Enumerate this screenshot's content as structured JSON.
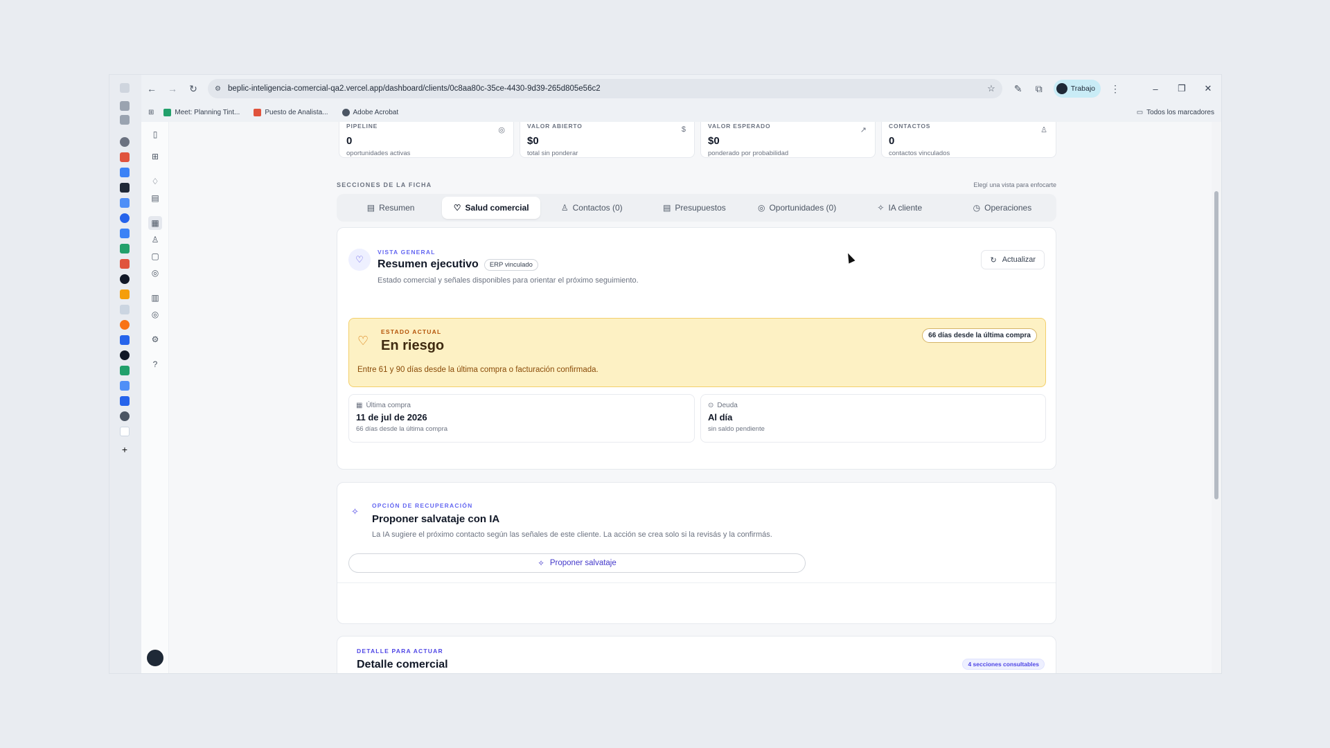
{
  "browser": {
    "url": "beplic-inteligencia-comercial-qa2.vercel.app/dashboard/clients/0c8aa80c-35ce-4430-9d39-265d805e56c2",
    "profile": "Trabajo",
    "bookmarks": [
      {
        "label": "Meet: Planning Tint...",
        "color": "#22a06b"
      },
      {
        "label": "Puesto de Analista...",
        "color": "#e0533d"
      },
      {
        "label": "Adobe Acrobat",
        "color": "#4b5563"
      }
    ],
    "all_bookmarks": "Todos los marcadores"
  },
  "stats": [
    {
      "label": "PIPELINE",
      "value": "0",
      "sub": "oportunidades activas",
      "icon": "target-icon"
    },
    {
      "label": "VALOR ABIERTO",
      "value": "$0",
      "sub": "total sin ponderar",
      "icon": "dollar-icon"
    },
    {
      "label": "VALOR ESPERADO",
      "value": "$0",
      "sub": "ponderado por probabilidad",
      "icon": "trend-icon"
    },
    {
      "label": "CONTACTOS",
      "value": "0",
      "sub": "contactos vinculados",
      "icon": "users-icon"
    }
  ],
  "sections": {
    "title": "SECCIONES DE LA FICHA",
    "hint": "Elegí una vista para enfocarte",
    "tabs": [
      "Resumen",
      "Salud comercial",
      "Contactos (0)",
      "Presupuestos",
      "Oportunidades (0)",
      "IA cliente",
      "Operaciones"
    ],
    "active_tab": "Salud comercial"
  },
  "overview": {
    "eyebrow": "VISTA GENERAL",
    "title": "Resumen ejecutivo",
    "chip": "ERP vinculado",
    "desc": "Estado comercial y señales disponibles para orientar el próximo seguimiento.",
    "update_btn": "Actualizar"
  },
  "status": {
    "eyebrow": "ESTADO ACTUAL",
    "title": "En riesgo",
    "badge": "66 días desde la última compra",
    "desc": "Entre 61 y 90 días desde la última compra o facturación confirmada."
  },
  "last_purchase": {
    "label": "Última compra",
    "value": "11 de jul de 2026",
    "sub": "66 días desde la última compra"
  },
  "debt": {
    "label": "Deuda",
    "value": "Al día",
    "sub": "sin saldo pendiente"
  },
  "recovery": {
    "eyebrow": "OPCIÓN DE RECUPERACIÓN",
    "title": "Proponer salvataje con IA",
    "desc": "La IA sugiere el próximo contacto según las señales de este cliente. La acción se crea solo si la revisás y la confirmás.",
    "button": "Proponer salvataje"
  },
  "detail": {
    "eyebrow": "DETALLE PARA ACTUAR",
    "title": "Detalle comercial",
    "badge": "4 secciones consultables"
  },
  "colors": {
    "accent": "#4f46e5",
    "risk_bg": "#fdf1c4",
    "risk_border": "#f3cf6b"
  }
}
